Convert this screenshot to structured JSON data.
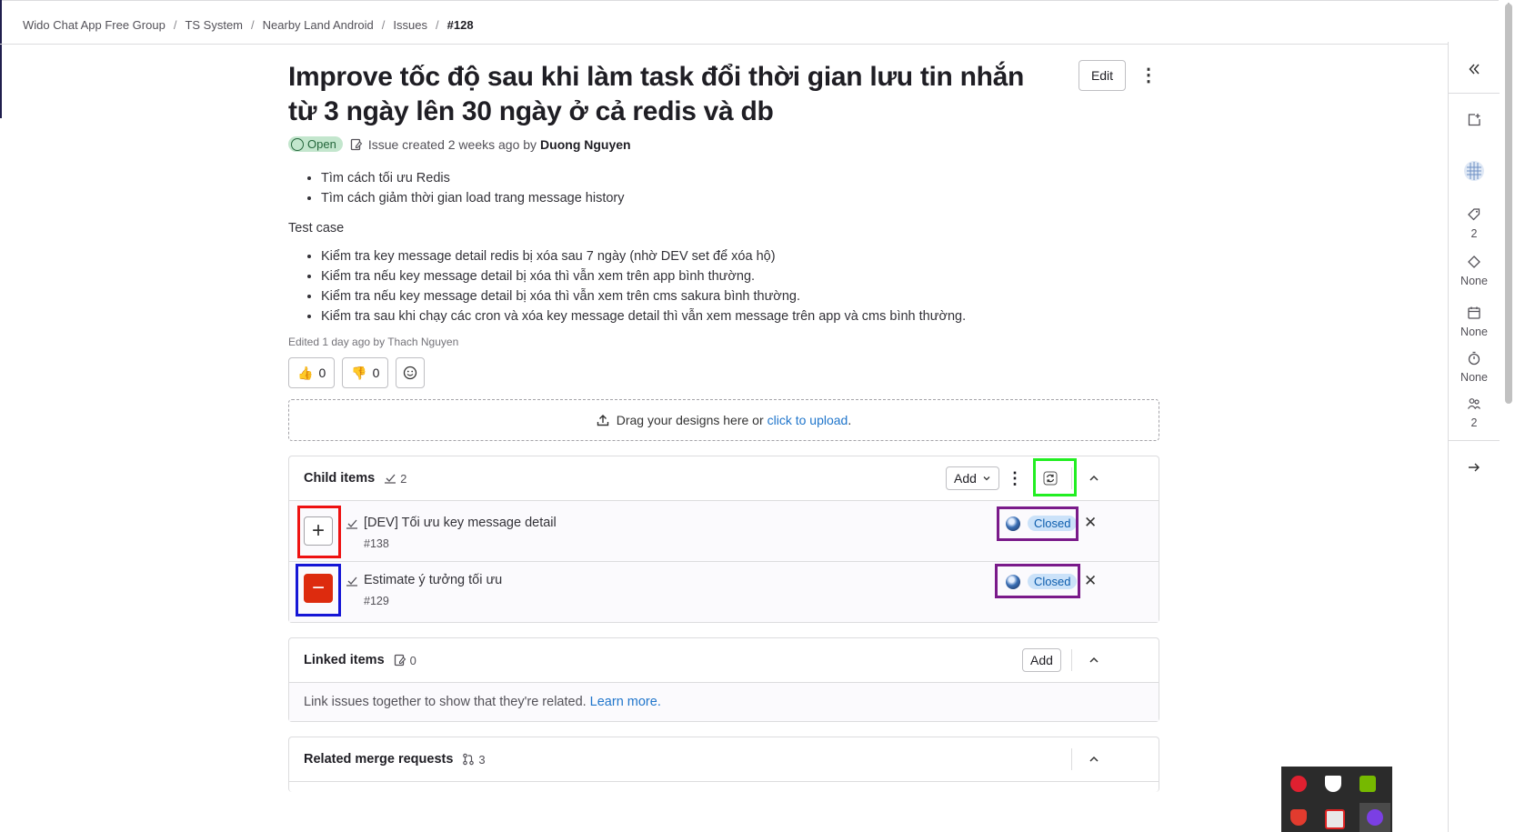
{
  "breadcrumb": {
    "items": [
      "Wido Chat App Free Group",
      "TS System",
      "Nearby Land Android",
      "Issues"
    ],
    "current": "#128"
  },
  "issue": {
    "title": "Improve tốc độ sau khi làm task đổi thời gian lưu tin nhắn từ 3 ngày lên 30 ngày ở cả redis và db",
    "edit_label": "Edit",
    "status": "Open",
    "meta_text": "Issue created 2 weeks ago by",
    "author": "Duong Nguyen",
    "bullets_1": [
      "Tìm cách tối ưu Redis",
      "Tìm cách giảm thời gian load trang message history"
    ],
    "test_case_heading": "Test case",
    "bullets_2": [
      "Kiểm tra key message detail redis bị xóa sau 7 ngày (nhờ DEV set để xóa hộ)",
      "Kiểm tra nếu key message detail bị xóa thì vẫn xem trên app bình thường.",
      "Kiểm tra nếu key message detail bị xóa thì vẫn xem trên cms sakura bình thường.",
      "Kiểm tra sau khi chạy các cron và xóa key message detail thì vẫn xem message trên app và cms bình thường."
    ],
    "edited_text": "Edited 1 day ago by Thach Nguyen"
  },
  "awards": {
    "thumbs_up": "0",
    "thumbs_down": "0"
  },
  "dropzone": {
    "text": "Drag your designs here or",
    "link": "click to upload",
    "suffix": "."
  },
  "child_items": {
    "title": "Child items",
    "count": "2",
    "add_label": "Add",
    "items": [
      {
        "title": "[DEV] Tối ưu key message detail",
        "ref": "#138",
        "status": "Closed"
      },
      {
        "title": "Estimate ý tưởng tối ưu",
        "ref": "#129",
        "status": "Closed"
      }
    ]
  },
  "linked_items": {
    "title": "Linked items",
    "count": "0",
    "add_label": "Add",
    "empty_text": "Link issues together to show that they're related.",
    "learn_more": "Learn more."
  },
  "related_mrs": {
    "title": "Related merge requests",
    "count": "3"
  },
  "sidebar": {
    "labels_count": "2",
    "milestone": "None",
    "due_date": "None",
    "time_tracking": "None",
    "participants": "2"
  },
  "colors": {
    "accent_link": "#1f75cb",
    "open_badge": "#c3e6cd",
    "closed_badge": "#cbe2f9",
    "highlight_red": "#ee1111",
    "highlight_blue": "#1515d6",
    "highlight_green": "#22ee22",
    "highlight_purple": "#7a1a8a"
  }
}
